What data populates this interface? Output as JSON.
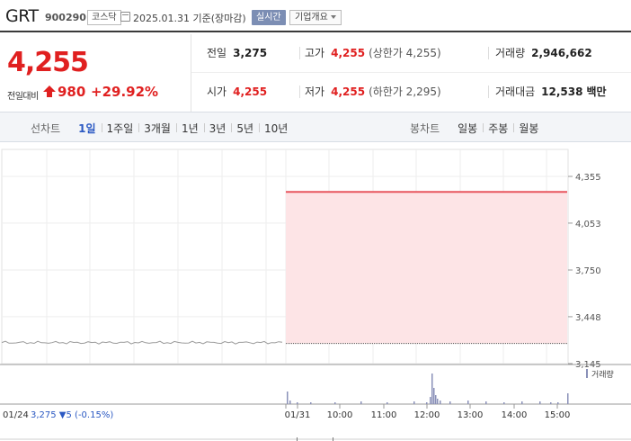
{
  "header": {
    "stock_name": "GRT",
    "stock_code": "900290",
    "market": "코스닥",
    "date_text": "2025.01.31 기준(장마감)",
    "realtime_label": "실시간",
    "company_info_label": "기업개요"
  },
  "price": {
    "current": "4,255",
    "diff_label": "전일대비",
    "diff_value": "980",
    "diff_percent": "+29.92%",
    "direction": "up",
    "up_color": "#e02020"
  },
  "stats": {
    "prev_close_label": "전일",
    "prev_close": "3,275",
    "high_label": "고가",
    "high": "4,255",
    "upper_limit": "(상한가 4,255)",
    "volume_label": "거래량",
    "volume": "2,946,662",
    "open_label": "시가",
    "open": "4,255",
    "low_label": "저가",
    "low": "4,255",
    "lower_limit": "(하한가 2,295)",
    "amount_label": "거래대금",
    "amount": "12,538",
    "amount_unit": "백만"
  },
  "line_tabs": {
    "title": "선차트",
    "items": [
      "1일",
      "1주일",
      "3개월",
      "1년",
      "3년",
      "5년",
      "10년"
    ],
    "active": "1일"
  },
  "candle_tabs": {
    "title": "봉차트",
    "items": [
      "일봉",
      "주봉",
      "월봉"
    ]
  },
  "chart_data": {
    "type": "line",
    "y_ticks": [
      "4,355",
      "4,053",
      "3,750",
      "3,448",
      "3,145"
    ],
    "ylim": [
      3145,
      4355
    ],
    "x_ticks": [
      "01/31",
      "10:00",
      "11:00",
      "12:00",
      "13:00",
      "14:00",
      "15:00"
    ],
    "prev_day_label": "01/24",
    "prev_close_caption": "3,275 ▼5 (-0.15%)",
    "prev_close_color": "#2b59c3",
    "prev_close": 3275,
    "series": [
      {
        "values": [
          4255,
          4255,
          4255,
          4255,
          4255,
          4255,
          4255,
          4255
        ]
      }
    ],
    "volume_legend": "거래량",
    "line_color": "#e8565f",
    "fill_color": "#fde4e6",
    "volume_color": "#8a90b8",
    "grid": true
  }
}
